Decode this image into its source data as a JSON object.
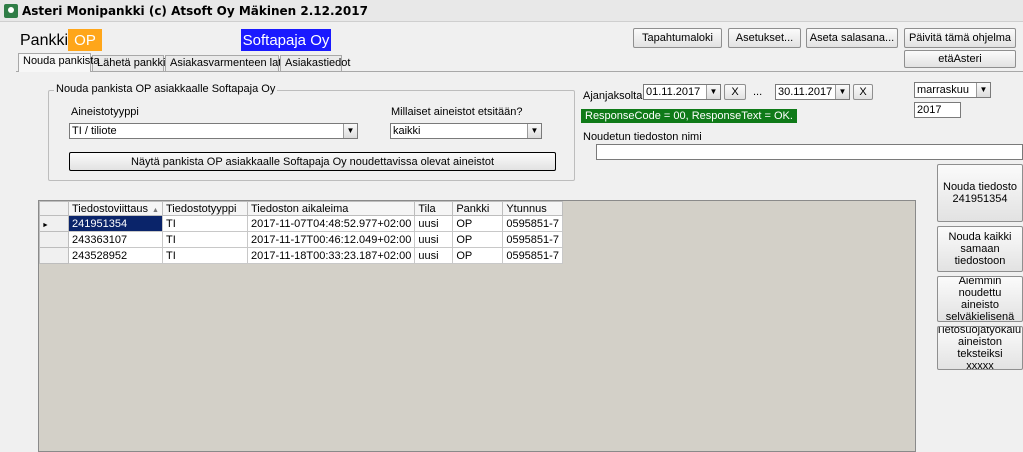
{
  "window": {
    "title": "Asteri Monipankki  (c) Atsoft Oy Mäkinen 2.12.2017"
  },
  "header": {
    "bank_label": "Pankki",
    "bank_name": "OP",
    "bank_color": "#ffa61a",
    "company": "Softapaja Oy",
    "company_color": "#1a1aff"
  },
  "toolbar": {
    "event_log": "Tapahtumaloki",
    "settings": "Asetukset...",
    "set_password": "Aseta salasana...",
    "update": "Päivitä tämä ohjelma",
    "eta": "etäAsteri"
  },
  "tabs": [
    {
      "label": "Nouda pankista",
      "active": true
    },
    {
      "label": "Lähetä pankkiin",
      "active": false
    },
    {
      "label": "Asiakasvarmenteen lataus",
      "active": false
    },
    {
      "label": "Asiakastiedot",
      "active": false
    }
  ],
  "group": {
    "title": "Nouda pankista OP asiakkaalle Softapaja Oy",
    "material_type_label": "Aineistotyyppi",
    "material_type_value": "TI / tiliote",
    "search_label": "Millaiset aineistot etsitään?",
    "search_value": "kaikki",
    "show_button": "Näytä pankista OP asiakkaalle Softapaja Oy noudettavissa olevat aineistot"
  },
  "period": {
    "label": "Ajanjaksolta",
    "from": "01.11.2017",
    "separator": "...",
    "to": "30.11.2017",
    "clear": "X",
    "month": "marraskuu",
    "year": "2017"
  },
  "status": {
    "text": "ResponseCode = 00, ResponseText = OK.",
    "color": "#0f7a18"
  },
  "filename": {
    "label": "Noudetun tiedoston nimi",
    "value": ""
  },
  "side_buttons": {
    "fetch_file": [
      "Nouda tiedosto",
      "241951354"
    ],
    "fetch_all": [
      "Nouda kaikki",
      "samaan",
      "tiedostoon"
    ],
    "previous": [
      "Aiemmin",
      "noudettu aineisto",
      "selväkielisenä"
    ],
    "privacy": [
      "Tietosuojatyökalu:",
      "aineiston teksteiksi",
      "xxxxx"
    ]
  },
  "grid": {
    "columns": [
      "Tiedostoviittaus",
      "Tiedostotyyppi",
      "Tiedoston aikaleima",
      "Tila",
      "Pankki",
      "Ytunnus"
    ],
    "rows": [
      [
        "241951354",
        "TI",
        "2017-11-07T04:48:52.977+02:00",
        "uusi",
        "OP",
        "0595851-7"
      ],
      [
        "243363107",
        "TI",
        "2017-11-17T00:46:12.049+02:00",
        "uusi",
        "OP",
        "0595851-7"
      ],
      [
        "243528952",
        "TI",
        "2017-11-18T00:33:23.187+02:00",
        "uusi",
        "OP",
        "0595851-7"
      ]
    ]
  }
}
